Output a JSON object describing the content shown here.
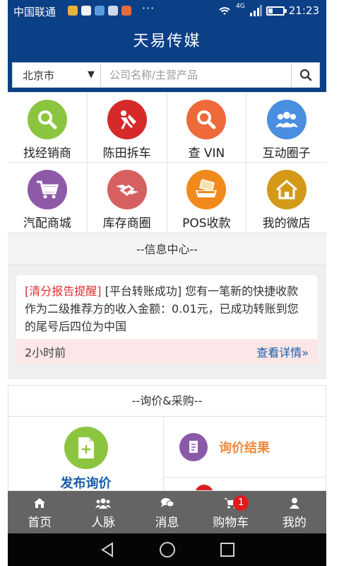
{
  "status_bar": {
    "carrier": "中国联通",
    "more": "···",
    "network": "4G",
    "time": "21:23"
  },
  "header": {
    "title": "天易传媒"
  },
  "search": {
    "city": "北京市",
    "placeholder": "公司名称/主营产品"
  },
  "features": [
    {
      "label": "找经销商",
      "icon": "search-icon",
      "color": "#8bc53f"
    },
    {
      "label": "陈田拆车",
      "icon": "dismantle-icon",
      "color": "#d62a2a"
    },
    {
      "label": "查 VIN",
      "icon": "search-icon",
      "color": "#ee6a3a"
    },
    {
      "label": "互动圈子",
      "icon": "people-icon",
      "color": "#4a8ee0"
    },
    {
      "label": "汽配商城",
      "icon": "cart-icon",
      "color": "#8e5aa8"
    },
    {
      "label": "库存商圈",
      "icon": "handshake-icon",
      "color": "#d66060"
    },
    {
      "label": "POS收款",
      "icon": "pos-icon",
      "color": "#f08a1c"
    },
    {
      "label": "我的微店",
      "icon": "house-icon",
      "color": "#d39a1a"
    }
  ],
  "info_center": {
    "title": "--信息中心--",
    "message": {
      "tag": "[清分报告提醒]",
      "text": " [平台转账成功] 您有一笔新的快捷收款作为二级推荐方的收入金额：0.01元，已成功转账到您的尾号后四位为中国",
      "time": "2小时前",
      "detail_link": "查看详情»"
    }
  },
  "inquiry": {
    "title": "--询价&采购--",
    "publish_label": "发布询价",
    "result_label": "询价结果"
  },
  "tabbar": {
    "items": [
      {
        "label": "首页",
        "icon": "home-icon"
      },
      {
        "label": "人脉",
        "icon": "contacts-icon"
      },
      {
        "label": "消息",
        "icon": "chat-icon"
      },
      {
        "label": "购物车",
        "icon": "cart-icon"
      },
      {
        "label": "我的",
        "icon": "user-icon"
      }
    ],
    "cart_badge": "1"
  },
  "colors": {
    "brand_blue": "#0b3f86",
    "tabbar_gray": "#646464",
    "link_blue": "#1a5ca8",
    "alert_red": "#e03030"
  }
}
